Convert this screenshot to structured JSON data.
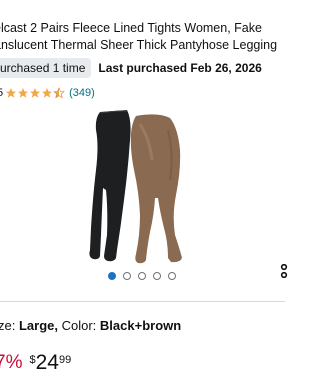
{
  "product": {
    "title_line1": "elcast 2 Pairs Fleece Lined Tights Women, Fake",
    "title_line2": "anslucent Thermal Sheer Thick Pantyhose Legging"
  },
  "purchase": {
    "badge": "urchased 1 time",
    "last_purchased": "Last purchased Feb 26, 2026"
  },
  "rating": {
    "value": "5",
    "stars": 4.5,
    "count": "(349)",
    "star_color": "#f3a847"
  },
  "carousel": {
    "total_dots": 5,
    "active_index": 0,
    "active_color": "#1a73c6"
  },
  "variant": {
    "size_label": "ze:",
    "size_value": "Large,",
    "color_label": "Color:",
    "color_value": "Black+brown"
  },
  "price": {
    "discount": "7%",
    "symbol": "$",
    "whole": "24",
    "fraction": "99",
    "discount_color": "#cc0c39"
  },
  "icons": {
    "share": "share-icon",
    "star": "star-icon"
  }
}
